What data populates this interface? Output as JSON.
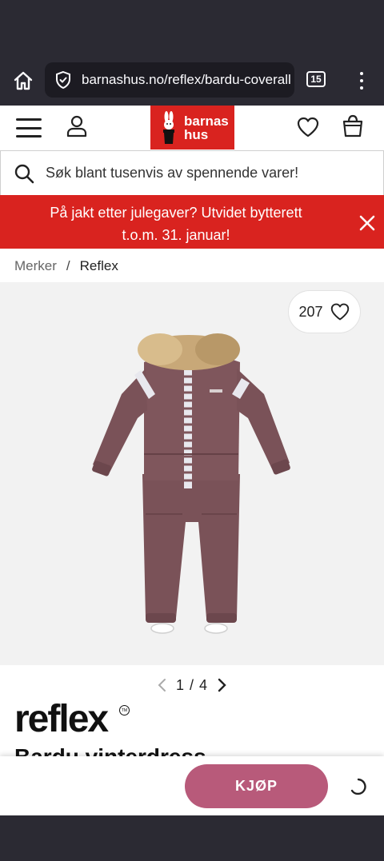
{
  "browser": {
    "url": "barnashus.no/reflex/bardu-coverall",
    "tab_count": "15"
  },
  "header": {
    "logo_line1": "barnas",
    "logo_line2": "hus"
  },
  "search": {
    "placeholder": "Søk blant tusenvis av spennende varer!"
  },
  "promo": {
    "text": "På jakt etter julegaver? Utvidet bytterett t.o.m. 31. januar!"
  },
  "breadcrumb": {
    "items": [
      "Merker",
      "Reflex"
    ],
    "separator": "/"
  },
  "product": {
    "favorites_count": "207",
    "image_pager": "1 / 4",
    "brand": "reflex",
    "title": "Bardu vinterdress",
    "buy_label": "KJØP"
  },
  "colors": {
    "brand_red": "#d9231f",
    "buy_button": "#b85a7a",
    "browser_chrome": "#2b2a33"
  }
}
